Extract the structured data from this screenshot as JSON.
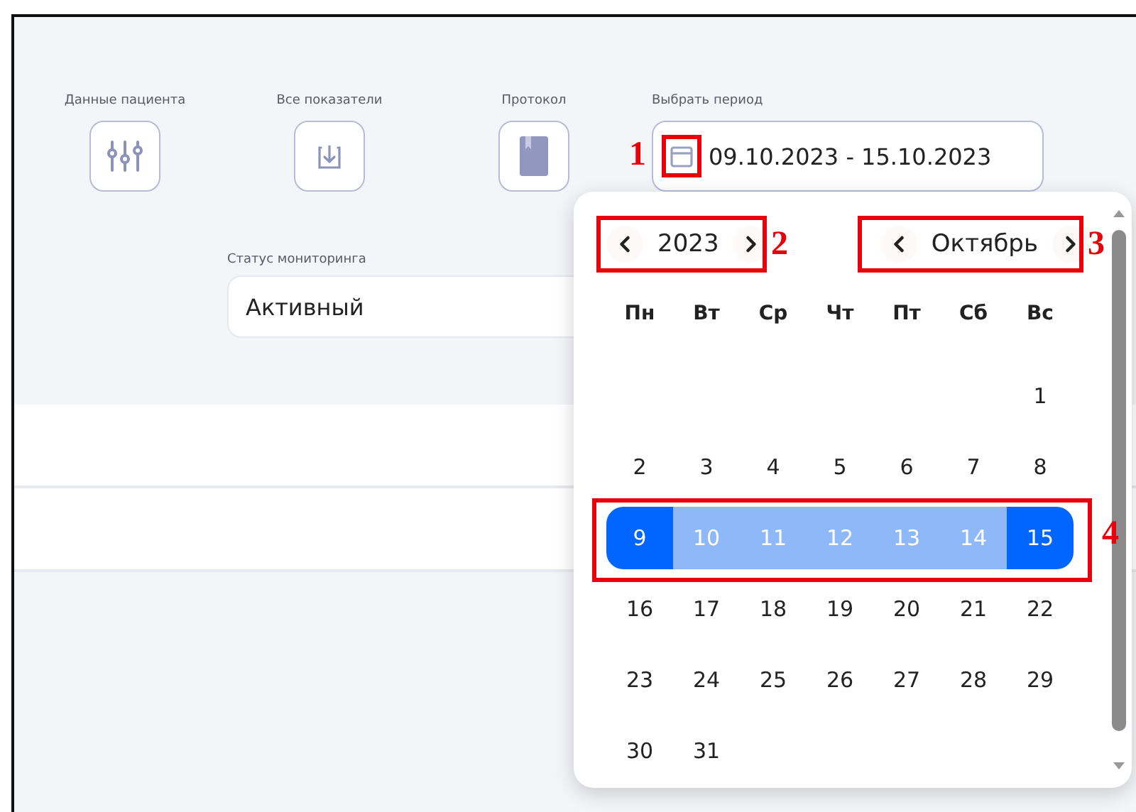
{
  "toolbar": [
    {
      "label": "Данные пациента",
      "kind": "sliders"
    },
    {
      "label": "Все показатели",
      "kind": "download"
    },
    {
      "label": "Протокол",
      "kind": "book"
    }
  ],
  "period": {
    "label": "Выбрать период",
    "value": "09.10.2023 - 15.10.2023"
  },
  "status": {
    "label": "Статус мониторинга",
    "value": "Активный"
  },
  "calendar": {
    "year": "2023",
    "month": "Октябрь",
    "weekdays": [
      "Пн",
      "Вт",
      "Ср",
      "Чт",
      "Пт",
      "Сб",
      "Вс"
    ],
    "weeks": [
      {
        "days": [
          {
            "day": "1",
            "selected": false,
            "in_range": false
          }
        ]
      },
      {
        "days": [
          {
            "day": "2",
            "selected": false,
            "in_range": false
          },
          {
            "day": "3",
            "selected": false,
            "in_range": false
          },
          {
            "day": "4",
            "selected": false,
            "in_range": false
          },
          {
            "day": "5",
            "selected": false,
            "in_range": false
          },
          {
            "day": "6",
            "selected": false,
            "in_range": false
          },
          {
            "day": "7",
            "selected": false,
            "in_range": false
          },
          {
            "day": "8",
            "selected": false,
            "in_range": false
          }
        ]
      },
      {
        "days": [
          {
            "day": "9",
            "selected": true,
            "in_range": true
          },
          {
            "day": "10",
            "selected": false,
            "in_range": true
          },
          {
            "day": "11",
            "selected": false,
            "in_range": true
          },
          {
            "day": "12",
            "selected": false,
            "in_range": true
          },
          {
            "day": "13",
            "selected": false,
            "in_range": true
          },
          {
            "day": "14",
            "selected": false,
            "in_range": true
          },
          {
            "day": "15",
            "selected": true,
            "in_range": true
          }
        ]
      },
      {
        "days": [
          {
            "day": "16",
            "selected": false,
            "in_range": false
          },
          {
            "day": "17",
            "selected": false,
            "in_range": false
          },
          {
            "day": "18",
            "selected": false,
            "in_range": false
          },
          {
            "day": "19",
            "selected": false,
            "in_range": false
          },
          {
            "day": "20",
            "selected": false,
            "in_range": false
          },
          {
            "day": "21",
            "selected": false,
            "in_range": false
          },
          {
            "day": "22",
            "selected": false,
            "in_range": false
          }
        ]
      },
      {
        "days": [
          {
            "day": "23",
            "selected": false,
            "in_range": false
          },
          {
            "day": "24",
            "selected": false,
            "in_range": false
          },
          {
            "day": "25",
            "selected": false,
            "in_range": false
          },
          {
            "day": "26",
            "selected": false,
            "in_range": false
          },
          {
            "day": "27",
            "selected": false,
            "in_range": false
          },
          {
            "day": "28",
            "selected": false,
            "in_range": false
          },
          {
            "day": "29",
            "selected": false,
            "in_range": false
          }
        ]
      },
      {
        "days": [
          {
            "day": "30",
            "selected": false,
            "in_range": false
          },
          {
            "day": "31",
            "selected": false,
            "in_range": false
          }
        ]
      }
    ]
  },
  "annotations": [
    {
      "number": "1"
    },
    {
      "number": "2"
    },
    {
      "number": "3"
    },
    {
      "number": "4"
    }
  ]
}
